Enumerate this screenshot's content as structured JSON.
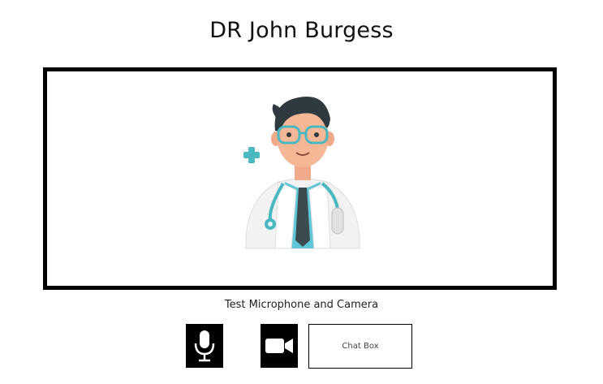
{
  "doctor": {
    "name": "DR John Burgess"
  },
  "video": {
    "avatar_icon": "doctor-avatar-icon"
  },
  "controls": {
    "caption": "Test Microphone and Camera",
    "microphone_icon": "microphone-icon",
    "camera_icon": "video-camera-icon",
    "chat_label": "Chat Box"
  },
  "colors": {
    "frame": "#000000",
    "button_bg": "#000000",
    "accent_teal": "#4ab8c1"
  }
}
